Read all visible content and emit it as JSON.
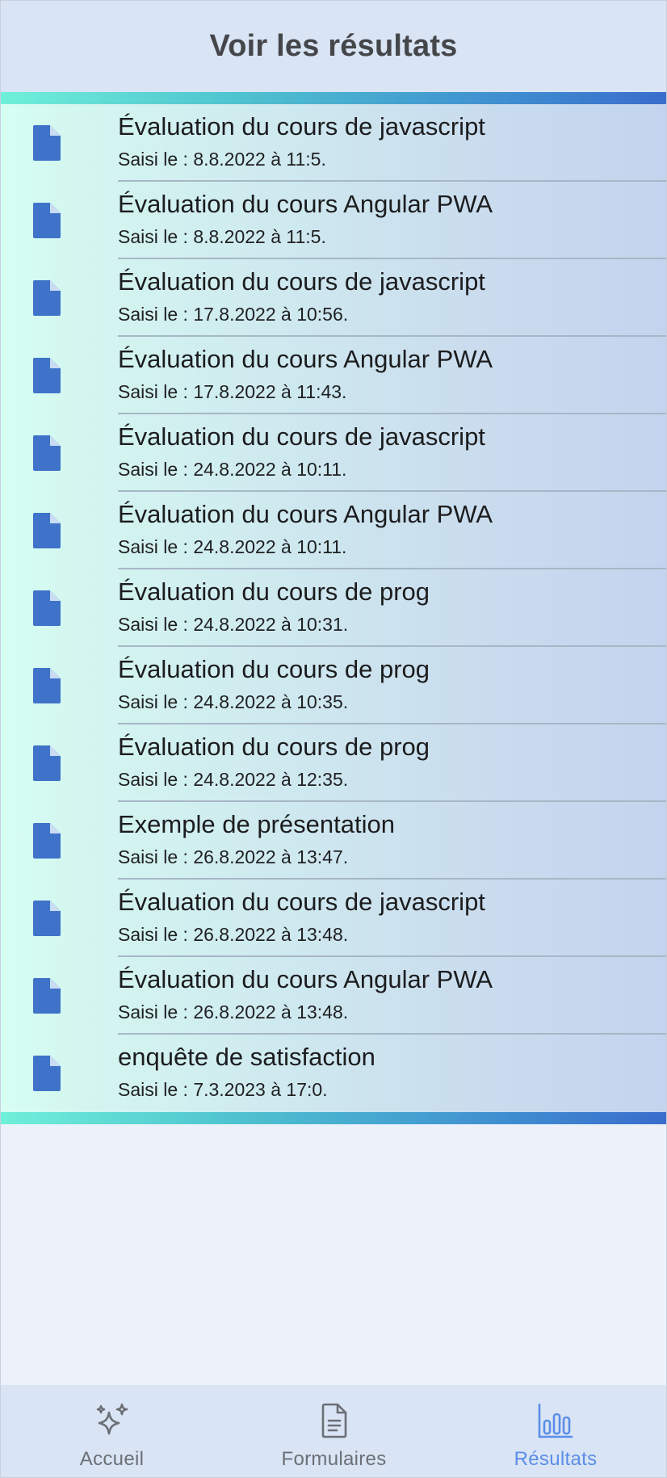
{
  "header": {
    "title": "Voir les résultats"
  },
  "results": [
    {
      "title": "Évaluation du cours de javascript",
      "subtitle": "Saisi le : 8.8.2022 à 11:5."
    },
    {
      "title": "Évaluation du cours Angular PWA",
      "subtitle": "Saisi le : 8.8.2022 à 11:5."
    },
    {
      "title": "Évaluation du cours de javascript",
      "subtitle": "Saisi le : 17.8.2022 à 10:56."
    },
    {
      "title": "Évaluation du cours Angular PWA",
      "subtitle": "Saisi le : 17.8.2022 à 11:43."
    },
    {
      "title": "Évaluation du cours de javascript",
      "subtitle": "Saisi le : 24.8.2022 à 10:11."
    },
    {
      "title": "Évaluation du cours Angular PWA",
      "subtitle": "Saisi le : 24.8.2022 à 10:11."
    },
    {
      "title": "Évaluation du cours de prog",
      "subtitle": "Saisi le : 24.8.2022 à 10:31."
    },
    {
      "title": "Évaluation du cours de prog",
      "subtitle": "Saisi le : 24.8.2022 à 10:35."
    },
    {
      "title": "Évaluation du cours de prog",
      "subtitle": "Saisi le : 24.8.2022 à 12:35."
    },
    {
      "title": "Exemple de présentation",
      "subtitle": "Saisi le : 26.8.2022 à 13:47."
    },
    {
      "title": "Évaluation du cours de javascript",
      "subtitle": "Saisi le : 26.8.2022 à 13:48."
    },
    {
      "title": "Évaluation du cours Angular PWA",
      "subtitle": "Saisi le : 26.8.2022 à 13:48."
    },
    {
      "title": "enquête de satisfaction",
      "subtitle": "Saisi le : 7.3.2023 à 17:0."
    }
  ],
  "row_icon": "file-icon",
  "nav": {
    "items": [
      {
        "label": "Accueil",
        "icon": "sparkles-icon",
        "active": false
      },
      {
        "label": "Formulaires",
        "icon": "document-icon",
        "active": false
      },
      {
        "label": "Résultats",
        "icon": "bar-chart-icon",
        "active": true
      }
    ]
  },
  "colors": {
    "header_bg": "#d9e4f4",
    "accent": "#5b8de8",
    "icon_blue": "#3f73c9",
    "bar_start": "#6ff0d9",
    "bar_end": "#3a6dcc",
    "inactive_nav": "#6b6f75"
  }
}
